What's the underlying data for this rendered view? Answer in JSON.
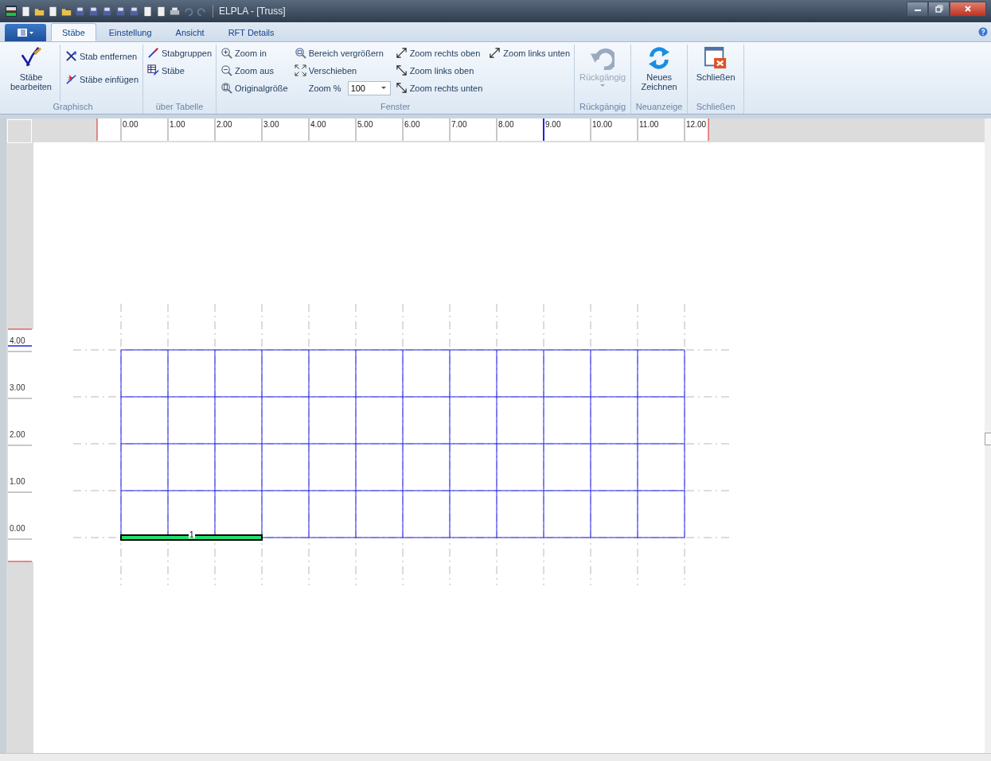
{
  "window": {
    "title": "ELPLA - [Truss]"
  },
  "tabs": [
    {
      "label": "Stäbe",
      "selected": true
    },
    {
      "label": "Einstellung",
      "selected": false
    },
    {
      "label": "Ansicht",
      "selected": false
    },
    {
      "label": "RFT Details",
      "selected": false
    }
  ],
  "ribbon": [
    {
      "label": "Graphisch",
      "columns": [
        [
          {
            "kind": "large",
            "label": "Stäbe bearbeiten",
            "disabled": false
          }
        ],
        [
          {
            "kind": "small",
            "label": "Stab entfernen"
          },
          {
            "kind": "small",
            "label": "Stäbe einfügen"
          }
        ]
      ]
    },
    {
      "label": "über Tabelle",
      "columns": [
        [
          {
            "kind": "small",
            "label": "Stabgruppen"
          },
          {
            "kind": "small",
            "label": "Stäbe"
          }
        ]
      ]
    },
    {
      "label": "Fenster",
      "columns": [
        [
          {
            "kind": "small",
            "label": "Zoom in"
          },
          {
            "kind": "small",
            "label": "Zoom aus"
          },
          {
            "kind": "small",
            "label": "Originalgröße"
          }
        ],
        [
          {
            "kind": "small",
            "label": "Bereich vergrößern"
          },
          {
            "kind": "small",
            "label": "Verschieben"
          },
          {
            "kind": "combo",
            "label": "Zoom %",
            "value": "100"
          }
        ],
        [
          {
            "kind": "small",
            "label": "Zoom rechts oben"
          },
          {
            "kind": "small",
            "label": "Zoom links oben"
          },
          {
            "kind": "small",
            "label": "Zoom rechts unten"
          }
        ],
        [
          {
            "kind": "small",
            "label": "Zoom links unten"
          }
        ]
      ]
    },
    {
      "label": "Rückgängig",
      "columns": [
        [
          {
            "kind": "large",
            "label": "Rückgängig",
            "disabled": true,
            "dropdown": true
          }
        ]
      ]
    },
    {
      "label": "Neuanzeige",
      "columns": [
        [
          {
            "kind": "large",
            "label": "Neues Zeichnen",
            "disabled": false
          }
        ]
      ]
    },
    {
      "label": "Schließen",
      "columns": [
        [
          {
            "kind": "large",
            "label": "Schließen",
            "disabled": false
          }
        ]
      ]
    }
  ],
  "ruler_x": {
    "labels": [
      "0.00",
      "1.00",
      "2.00",
      "3.00",
      "4.00",
      "5.00",
      "6.00",
      "7.00",
      "8.00",
      "9.00",
      "10.00",
      "11.00",
      "12.00"
    ]
  },
  "ruler_y": {
    "labels": [
      "4.00",
      "3.00",
      "2.00",
      "1.00",
      "0.00"
    ]
  },
  "members": [
    {
      "label": "1"
    }
  ]
}
